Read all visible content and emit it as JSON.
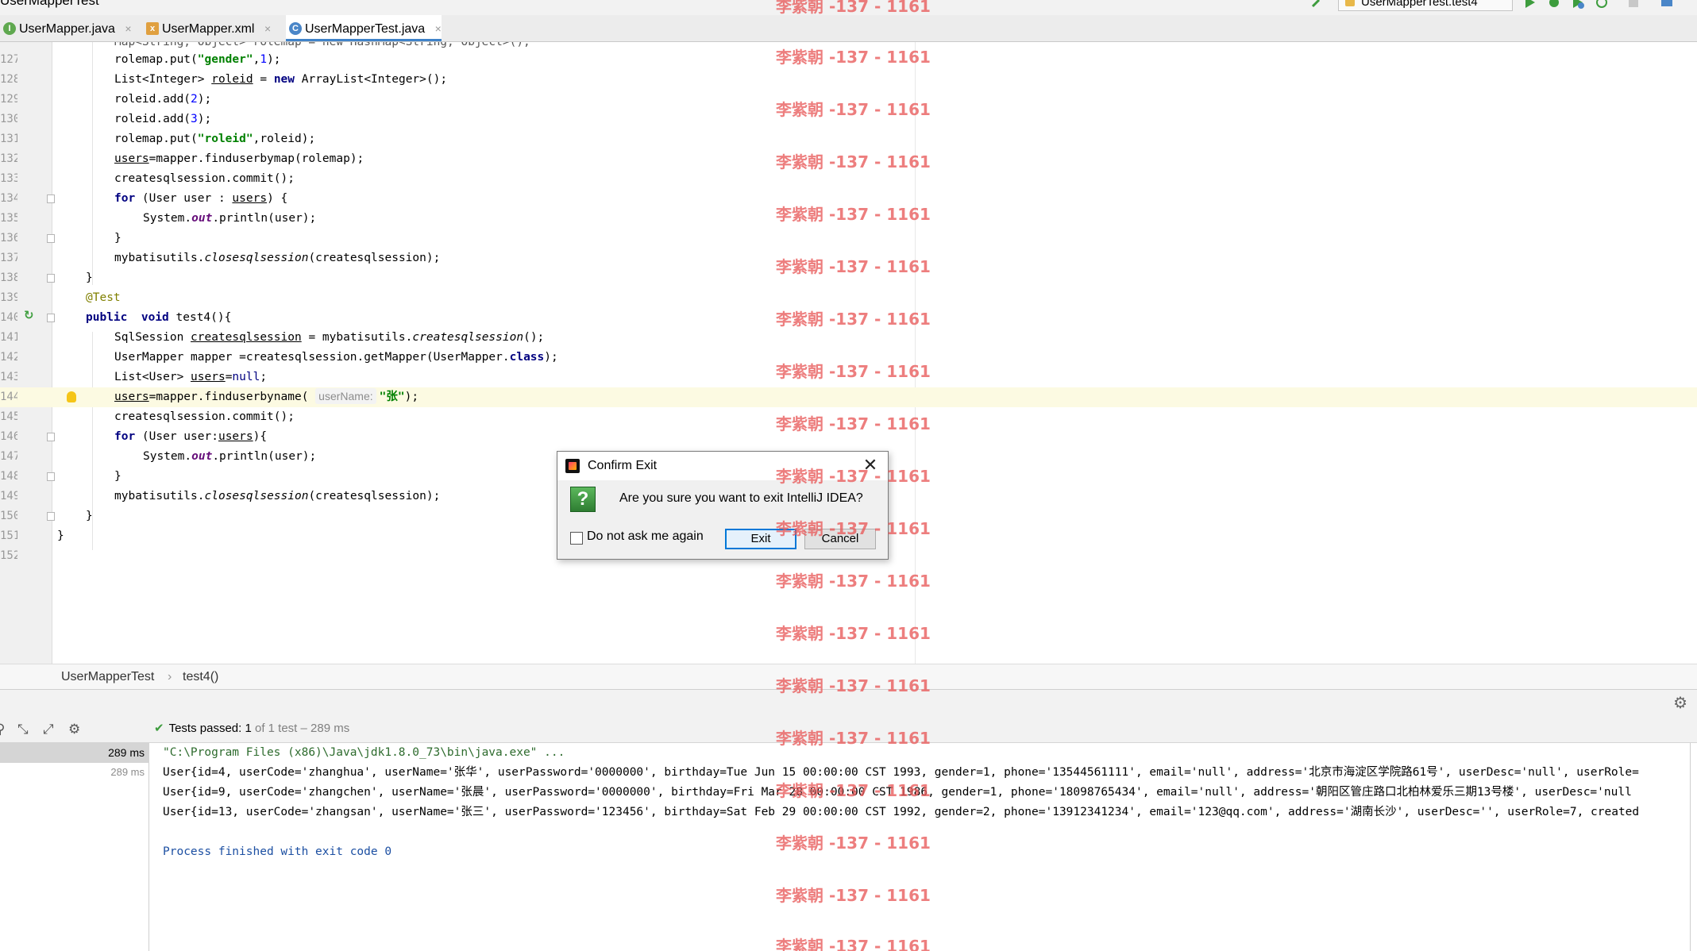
{
  "window": {
    "title": "UserMapperTest"
  },
  "toolbar": {
    "run_config": "UserMapperTest.test4"
  },
  "tabs": [
    {
      "label": "UserMapper.java",
      "icon": "interface-icon",
      "close": "×"
    },
    {
      "label": "UserMapper.xml",
      "icon": "xml-file-icon",
      "close": "×"
    },
    {
      "label": "UserMapperTest.java",
      "icon": "class-icon",
      "close": "×"
    }
  ],
  "editor": {
    "line_numbers": [
      "127",
      "128",
      "129",
      "130",
      "131",
      "132",
      "133",
      "134",
      "135",
      "136",
      "137",
      "138",
      "139",
      "140",
      "141",
      "142",
      "143",
      "144",
      "145",
      "146",
      "147",
      "148",
      "149",
      "150",
      "151",
      "152"
    ],
    "current_line": "144",
    "param_hint": "userName:"
  },
  "breadcrumb": {
    "class": "UserMapperTest",
    "separator": "›",
    "method": "test4()"
  },
  "run": {
    "status_prefix": "Tests passed:",
    "passed": "1",
    "status_suffix": "of 1 test – 289 ms",
    "tree": [
      {
        "time": "289 ms"
      },
      {
        "time": "289 ms"
      }
    ],
    "console": [
      "\"C:\\Program Files (x86)\\Java\\jdk1.8.0_73\\bin\\java.exe\" ...",
      "User{id=4, userCode='zhanghua', userName='张华', userPassword='0000000', birthday=Tue Jun 15 00:00:00 CST 1993, gender=1, phone='13544561111', email='null', address='北京市海淀区学院路61号', userDesc='null', userRole=",
      "User{id=9, userCode='zhangchen', userName='张晨', userPassword='0000000', birthday=Fri Mar 28 00:00:00 CST 1986, gender=1, phone='18098765434', email='null', address='朝阳区管庄路口北柏林爱乐三期13号楼', userDesc='null",
      "User{id=13, userCode='zhangsan', userName='张三', userPassword='123456', birthday=Sat Feb 29 00:00:00 CST 1992, gender=2, phone='13912341234', email='123@qq.com', address='湖南长沙', userDesc='', userRole=7, created",
      "",
      "Process finished with exit code 0"
    ]
  },
  "dialog": {
    "title": "Confirm Exit",
    "close": "✕",
    "icon": "?",
    "message": "Are you sure you want to exit IntelliJ IDEA?",
    "checkbox_label": "Do not ask me again",
    "exit_label": "Exit",
    "cancel_label": "Cancel"
  },
  "watermark": {
    "text": "李紫朝 -137 - 1161"
  }
}
